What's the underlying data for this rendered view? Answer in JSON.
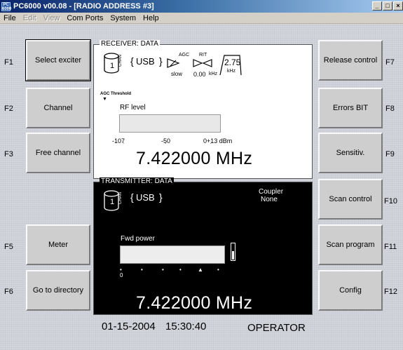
{
  "window": {
    "icon_text": "PC 6000",
    "title": "PC6000 v00.08 - [RADIO ADDRESS #3]",
    "buttons": {
      "minimize": "_",
      "maximize": "□",
      "close": "×"
    }
  },
  "menu": [
    {
      "label": "File",
      "enabled": true
    },
    {
      "label": "Edit",
      "enabled": false
    },
    {
      "label": "View",
      "enabled": false
    },
    {
      "label": "Com Ports",
      "enabled": true
    },
    {
      "label": "System",
      "enabled": true
    },
    {
      "label": "Help",
      "enabled": true
    }
  ],
  "left_buttons": [
    {
      "key": "F1",
      "label": "Select exciter"
    },
    {
      "key": "F2",
      "label": "Channel"
    },
    {
      "key": "F3",
      "label": "Free channel"
    },
    {
      "key": "F5",
      "label": "Meter"
    },
    {
      "key": "F6",
      "label": "Go to directory"
    }
  ],
  "right_buttons": [
    {
      "key": "F7",
      "label": "Release control"
    },
    {
      "key": "F8",
      "label": "Errors BIT"
    },
    {
      "key": "F9",
      "label": "Sensitiv."
    },
    {
      "key": "F10",
      "label": "Scan control"
    },
    {
      "key": "F11",
      "label": "Scan program"
    },
    {
      "key": "F12",
      "label": "Config"
    }
  ],
  "receiver": {
    "header": "RECEIVER: DATA",
    "channel": "1",
    "chan_label": "CHAN",
    "mode": "USB",
    "agc_label": "AGC",
    "agc_value": "slow",
    "rit_label": "RIT",
    "rit_value": "0.00",
    "rit_unit": "kHz",
    "filter_value": "2.75",
    "filter_unit": "kHz",
    "agc_threshold_label": "AGC Threshold",
    "rf_level_label": "RF level",
    "scale": [
      "-107",
      "-50",
      "0+13 dBm"
    ],
    "rf_level_fraction": 0,
    "frequency": "7.422000 MHz"
  },
  "transmitter": {
    "header": "TRANSMITTER: DATA",
    "channel": "1",
    "chan_label": "CHAN",
    "mode": "USB",
    "coupler_label": "Coupler",
    "coupler_value": "None",
    "fwd_power_label": "Fwd power",
    "scale_zero": "0",
    "fwd_power_fraction": 0,
    "frequency": "7.422000 MHz"
  },
  "status": {
    "date": "01-15-2004",
    "time": "15:30:40",
    "role": "OPERATOR"
  }
}
